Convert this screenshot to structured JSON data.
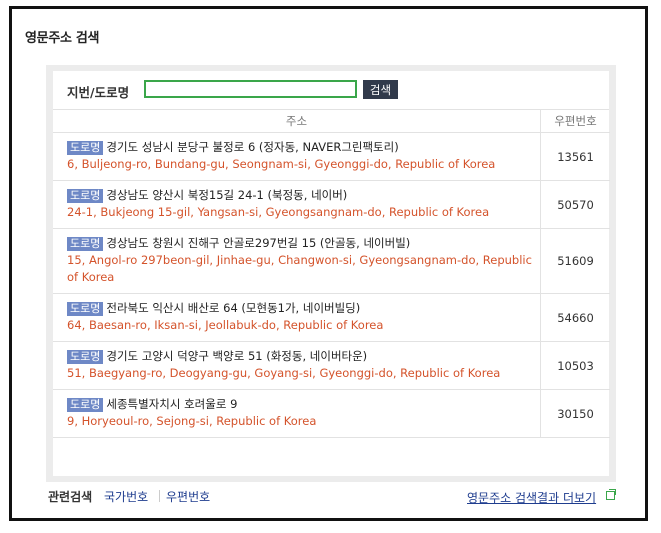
{
  "title": "영문주소 검색",
  "search": {
    "label": "지번/도로명",
    "value": "",
    "placeholder": "",
    "button": "검색"
  },
  "table": {
    "headers": [
      "주소",
      "우편번호"
    ],
    "badge": "도로명",
    "rows": [
      {
        "kr": "경기도 성남시 분당구 불정로 6 (정자동, NAVER그린팩토리)",
        "en": "6, Buljeong-ro, Bundang-gu, Seongnam-si, Gyeonggi-do, Republic of Korea",
        "zip": "13561"
      },
      {
        "kr": "경상남도 양산시 북정15길 24-1 (북정동, 네이버)",
        "en": "24-1, Bukjeong 15-gil, Yangsan-si, Gyeongsangnam-do, Republic of Korea",
        "zip": "50570"
      },
      {
        "kr": "경상남도 창원시 진해구 안골로297번길 15 (안골동, 네이버빌)",
        "en": "15, Angol-ro 297beon-gil, Jinhae-gu, Changwon-si, Gyeongsangnam-do, Republic of Korea",
        "zip": "51609"
      },
      {
        "kr": "전라북도 익산시 배산로 64 (모현동1가, 네이버빌딩)",
        "en": "64, Baesan-ro, Iksan-si, Jeollabuk-do, Republic of Korea",
        "zip": "54660"
      },
      {
        "kr": "경기도 고양시 덕양구 백양로 51 (화정동, 네이버타운)",
        "en": "51, Baegyang-ro, Deogyang-gu, Goyang-si, Gyeonggi-do, Republic of Korea",
        "zip": "10503"
      },
      {
        "kr": "세종특별자치시 호려울로 9",
        "en": "9, Horyeoul-ro, Sejong-si, Republic of Korea",
        "zip": "30150"
      }
    ]
  },
  "footer": {
    "related_label": "관련검색",
    "links": [
      "국가번호",
      "우편번호"
    ],
    "more": "영문주소 검색결과 더보기"
  }
}
